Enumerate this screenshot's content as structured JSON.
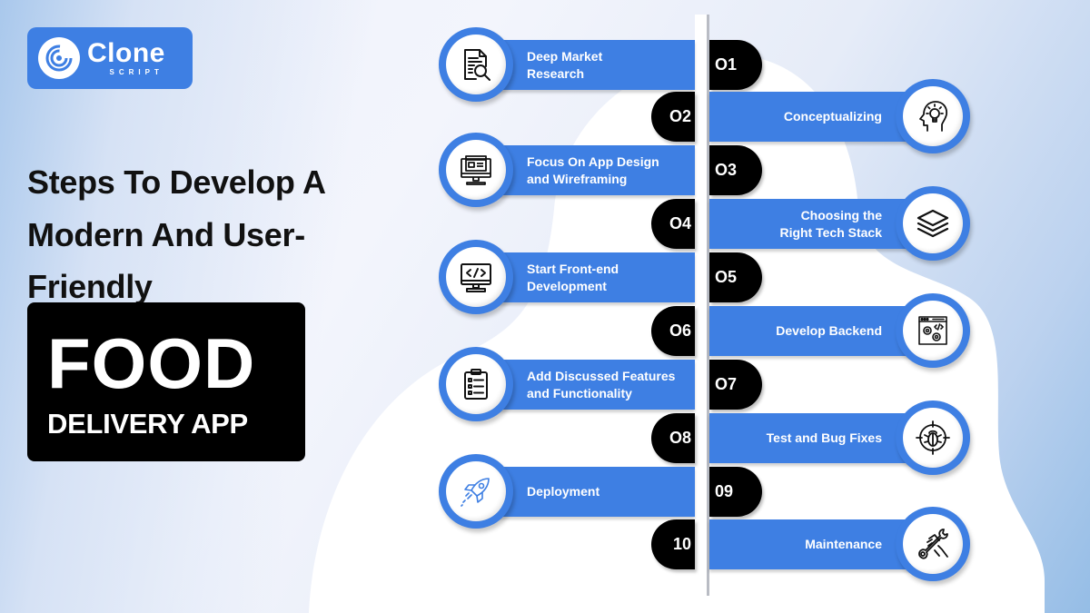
{
  "brand": {
    "name": "Clone",
    "sub": "SCRIPT",
    "color": "#3e7fe3"
  },
  "headline": {
    "lines": [
      "Steps To Develop A",
      "Modern And User-",
      "Friendly"
    ],
    "box_title": "FOOD",
    "box_subtitle": "DELIVERY APP"
  },
  "steps": [
    {
      "number": "01",
      "label_lines": [
        "Deep Market",
        "Research"
      ],
      "icon": "document-search-icon",
      "side": "left"
    },
    {
      "number": "02",
      "label_lines": [
        "Conceptualizing"
      ],
      "icon": "head-lightbulb-icon",
      "side": "right"
    },
    {
      "number": "03",
      "label_lines": [
        "Focus On App Design",
        "and Wireframing"
      ],
      "icon": "monitor-wireframe-icon",
      "side": "left"
    },
    {
      "number": "04",
      "label_lines": [
        "Choosing the",
        "Right Tech Stack"
      ],
      "icon": "layers-icon",
      "side": "right"
    },
    {
      "number": "05",
      "label_lines": [
        "Start Front-end",
        "Development"
      ],
      "icon": "monitor-code-icon",
      "side": "left"
    },
    {
      "number": "06",
      "label_lines": [
        "Develop Backend"
      ],
      "icon": "browser-gears-icon",
      "side": "right"
    },
    {
      "number": "07",
      "label_lines": [
        "Add Discussed Features",
        "and Functionality"
      ],
      "icon": "clipboard-list-icon",
      "side": "left"
    },
    {
      "number": "08",
      "label_lines": [
        "Test and Bug Fixes"
      ],
      "icon": "bug-target-icon",
      "side": "right"
    },
    {
      "number": "09",
      "label_lines": [
        "Deployment"
      ],
      "icon": "rocket-icon",
      "side": "left"
    },
    {
      "number": "10",
      "label_lines": [
        "Maintenance"
      ],
      "icon": "hand-wrench-icon",
      "side": "right"
    }
  ],
  "display_numbers": [
    "O1",
    "O2",
    "O3",
    "O4",
    "O5",
    "O6",
    "O7",
    "O8",
    "09",
    "10"
  ]
}
